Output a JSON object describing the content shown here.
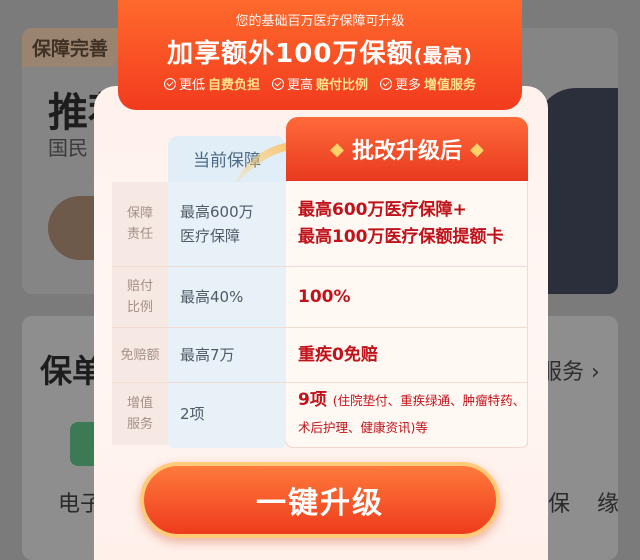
{
  "background": {
    "badge": "保障完善",
    "title": "推荐",
    "subtitle": "国民",
    "section_title": "保单",
    "service_link": "服务 ›",
    "bottom_left": "电子",
    "bottom_right": "保 缘"
  },
  "banner": {
    "small": "您的基础百万医疗保障可升级",
    "headline": "加享额外100万保额",
    "headline_suffix": "(最高)",
    "features": [
      {
        "prefix": "更低",
        "highlight": "自费负担"
      },
      {
        "prefix": "更高",
        "highlight": "赔付比例"
      },
      {
        "prefix": "更多",
        "highlight": "增值服务"
      }
    ]
  },
  "table": {
    "current_header": "当前保障",
    "new_header": "批改升级后",
    "rows": [
      {
        "label": "保障\n责任",
        "current": "最高600万\n医疗保障",
        "new": "最高600万医疗保障+\n最高100万医疗保额提额卡"
      },
      {
        "label": "赔付\n比例",
        "current": "最高40%",
        "new": "100%"
      },
      {
        "label": "免赔额",
        "current": "最高7万",
        "new": "重疾0免赔"
      },
      {
        "label": "增值\n服务",
        "current": "2项",
        "new_big": "9项",
        "new_note": "(住院垫付、重疾绿通、肿瘤特药、术后护理、健康资讯)等"
      }
    ]
  },
  "button": {
    "label": "一键升级"
  },
  "colors": {
    "accent": "#ee3b1c",
    "highlight_text": "#c0121a",
    "current_col": "#e8f1f8"
  }
}
